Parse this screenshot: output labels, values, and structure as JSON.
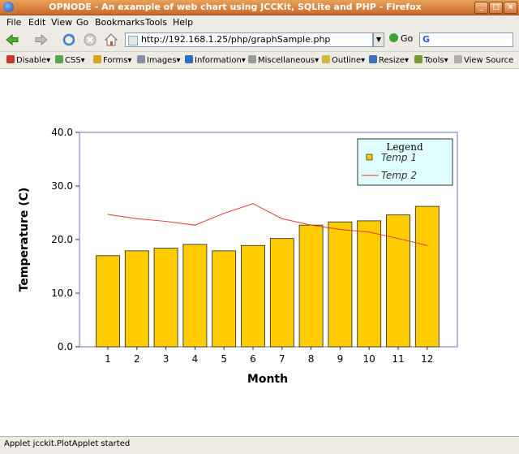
{
  "window": {
    "title": "OPNODE - An example of web chart using JCCKit, SQLite and PHP - Firefox",
    "controls": [
      "_",
      "□",
      "×"
    ]
  },
  "menu": [
    "File",
    "Edit",
    "View",
    "Go",
    "Bookmarks",
    "Tools",
    "Help"
  ],
  "navbar": {
    "url": "http://192.168.1.25/php/graphSample.php",
    "go_label": "Go",
    "search_placeholder": "G"
  },
  "devbar": [
    {
      "label": "Disable▾",
      "icon": "disable-icon",
      "color": "#c0392b"
    },
    {
      "label": "CSS▾",
      "icon": "css-icon",
      "color": "#55a84d"
    },
    {
      "label": "Forms▾",
      "icon": "forms-icon",
      "color": "#d9a21f"
    },
    {
      "label": "Images▾",
      "icon": "images-icon",
      "color": "#8a8fa6"
    },
    {
      "label": "Information▾",
      "icon": "information-icon",
      "color": "#2f6fc2"
    },
    {
      "label": "Miscellaneous▾",
      "icon": "miscellaneous-icon",
      "color": "#9a9a9a"
    },
    {
      "label": "Outline▾",
      "icon": "outline-icon",
      "color": "#d8b23c"
    },
    {
      "label": "Resize▾",
      "icon": "resize-icon",
      "color": "#3c6fb3"
    },
    {
      "label": "Tools▾",
      "icon": "tools-icon",
      "color": "#7a9a3a"
    },
    {
      "label": "View Source",
      "icon": "view-source-icon",
      "color": "#b0b0b0"
    }
  ],
  "status": "Applet jcckit.PlotApplet started",
  "chart_data": {
    "type": "bar",
    "xlabel": "Month",
    "ylabel": "Temperature (C)",
    "ylim": [
      0,
      40
    ],
    "yticks": [
      "0.0",
      "10.0",
      "20.0",
      "30.0",
      "40.0"
    ],
    "categories": [
      "1",
      "2",
      "3",
      "4",
      "5",
      "6",
      "7",
      "8",
      "9",
      "10",
      "11",
      "12"
    ],
    "legend": {
      "title": "Legend",
      "placement": "top-right"
    },
    "series": [
      {
        "name": "Temp 1",
        "kind": "bar",
        "color": "#ffcc00",
        "values": [
          17.0,
          17.9,
          18.4,
          19.1,
          17.9,
          18.9,
          20.2,
          22.7,
          23.3,
          23.5,
          24.6,
          26.2
        ]
      },
      {
        "name": "Temp 2",
        "kind": "line",
        "color": "#e8372a",
        "values": [
          24.7,
          23.9,
          23.4,
          22.7,
          24.9,
          26.7,
          23.9,
          22.7,
          21.9,
          21.4,
          20.2,
          18.9
        ]
      }
    ]
  }
}
